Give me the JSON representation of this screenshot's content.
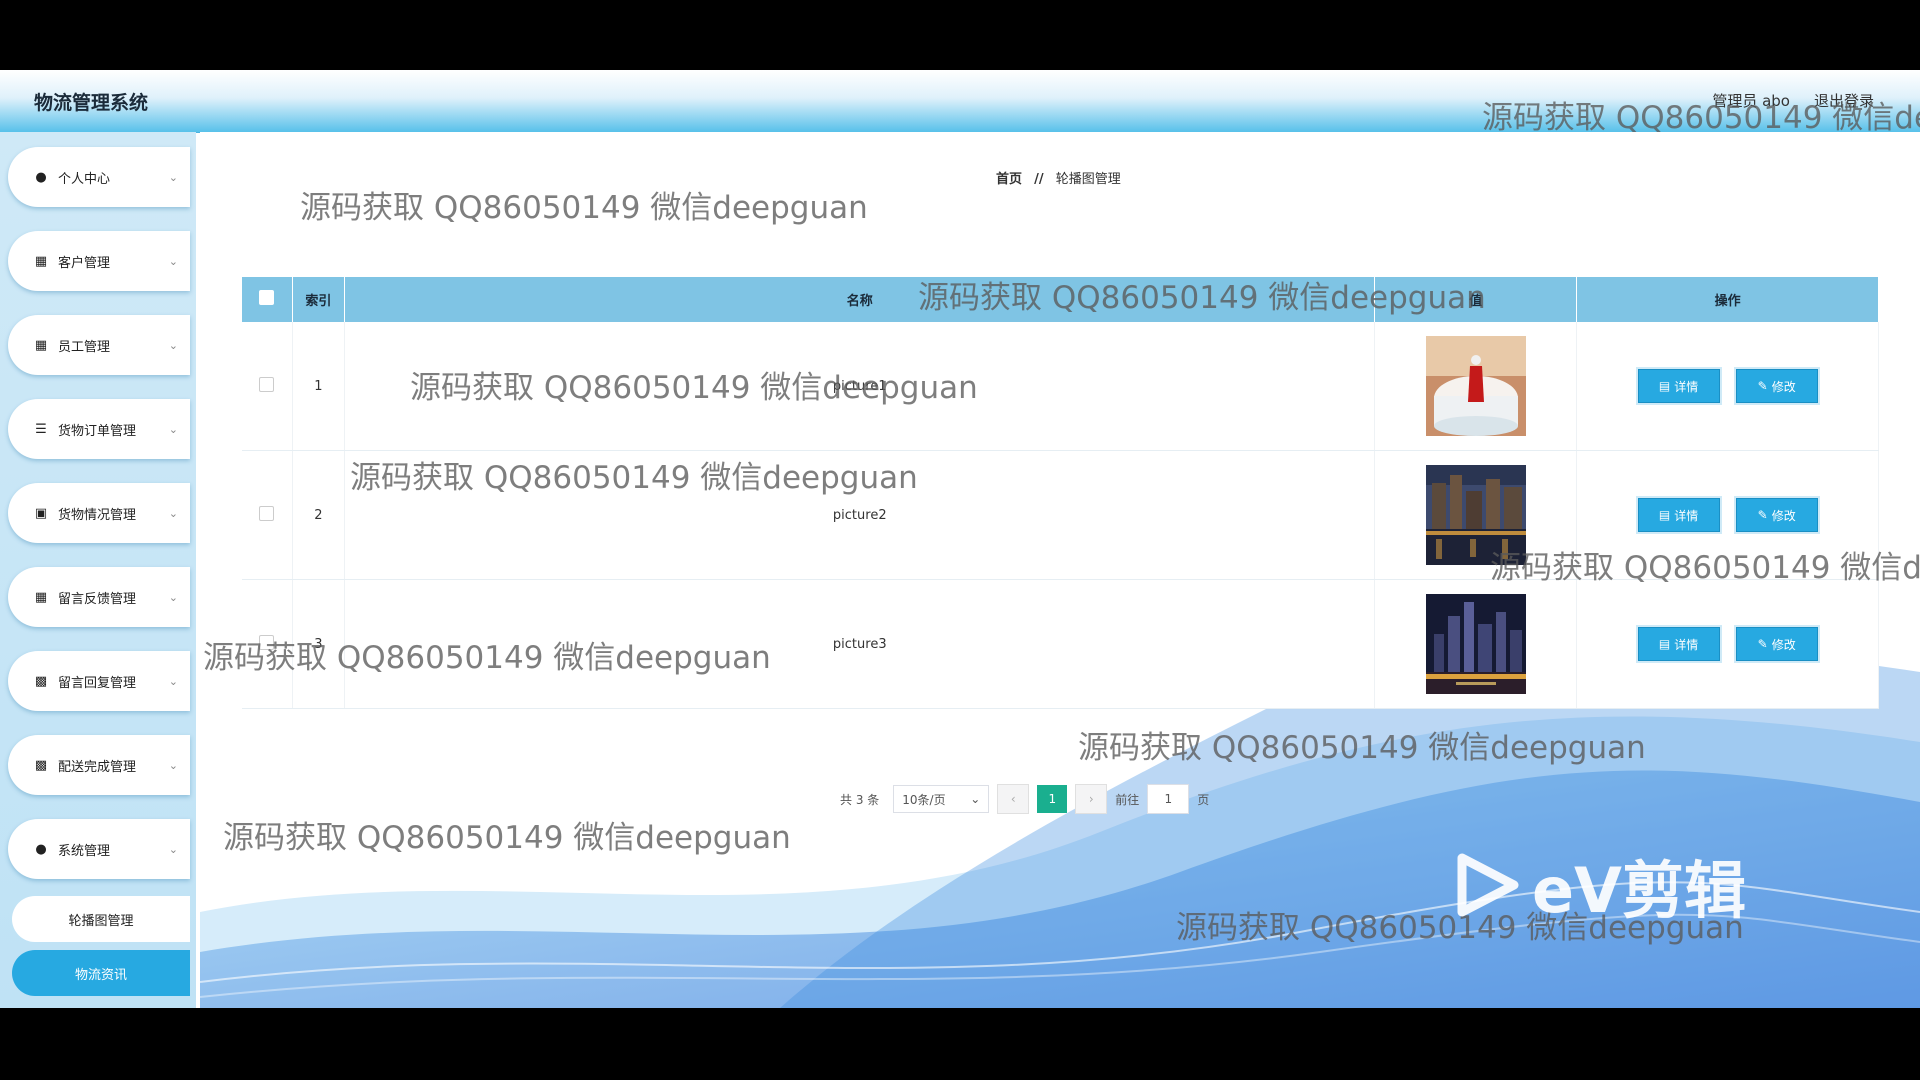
{
  "header": {
    "app_title": "物流管理系统",
    "user_label": "管理员 abo",
    "logout_label": "退出登录"
  },
  "sidebar": {
    "items": [
      {
        "label": "个人中心",
        "icon": "user-icon"
      },
      {
        "label": "客户管理",
        "icon": "grid-icon"
      },
      {
        "label": "员工管理",
        "icon": "grid-icon"
      },
      {
        "label": "货物订单管理",
        "icon": "list-icon"
      },
      {
        "label": "货物情况管理",
        "icon": "briefcase-icon"
      },
      {
        "label": "留言反馈管理",
        "icon": "grid-icon"
      },
      {
        "label": "留言回复管理",
        "icon": "clipboard-icon"
      },
      {
        "label": "配送完成管理",
        "icon": "clipboard-icon"
      },
      {
        "label": "系统管理",
        "icon": "user-icon"
      }
    ],
    "sub_items": [
      {
        "label": "轮播图管理",
        "active": false
      },
      {
        "label": "物流资讯",
        "active": true
      }
    ]
  },
  "breadcrumb": {
    "home": "首页",
    "separator": "//",
    "current": "轮播图管理"
  },
  "table": {
    "headers": [
      "索引",
      "名称",
      "值",
      "操作"
    ],
    "rows": [
      {
        "index": "1",
        "name": "picture1",
        "image": "cake-photo"
      },
      {
        "index": "2",
        "name": "picture2",
        "image": "city-night-photo"
      },
      {
        "index": "3",
        "name": "picture3",
        "image": "skyline-night-photo"
      }
    ],
    "detail_label": "详情",
    "edit_label": "修改"
  },
  "pagination": {
    "total_text": "共 3 条",
    "page_size": "10条/页",
    "current_page": "1",
    "goto_label": "前往",
    "goto_value": "1",
    "page_suffix": "页"
  },
  "watermark": "源码获取 QQ86050149 微信deepguan",
  "ev_logo": "eV剪辑",
  "colors": {
    "accent": "#27a9e1",
    "header_row": "#7fc4e4",
    "pager_active": "#1aaf8f"
  }
}
